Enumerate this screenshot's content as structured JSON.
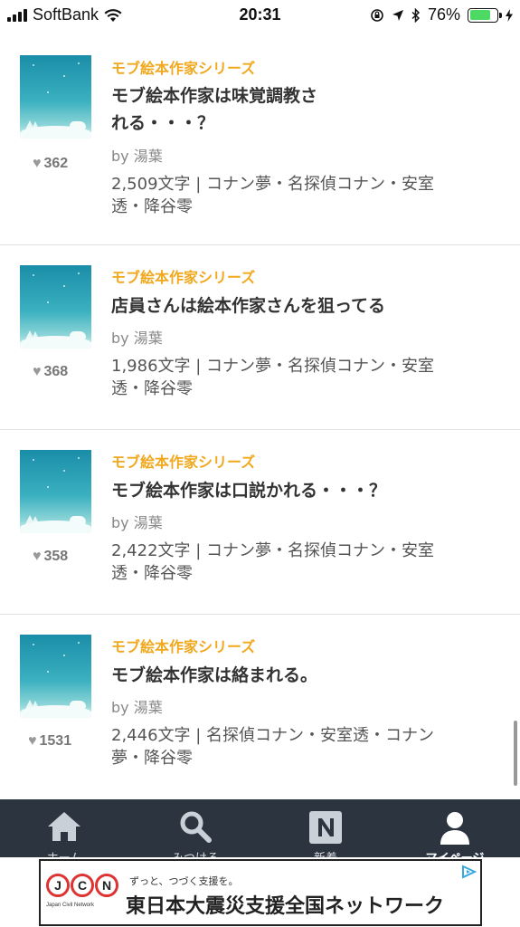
{
  "status_bar": {
    "carrier": "SoftBank",
    "time": "20:31",
    "battery": "76%",
    "battery_level": 0.76
  },
  "posts": [
    {
      "series": "モブ絵本作家シリーズ",
      "title_lines": [
        "モブ絵本作家は味覚調教さ",
        "れる・・・？"
      ],
      "author": "by 湯葉",
      "meta_lines": [
        "2,509文字 | コナン夢・名探偵コナン・安室",
        "透・降谷零"
      ],
      "likes": "362"
    },
    {
      "series": "モブ絵本作家シリーズ",
      "title_lines": [
        "店員さんは絵本作家さんを狙ってる"
      ],
      "author": "by 湯葉",
      "meta_lines": [
        "1,986文字 | コナン夢・名探偵コナン・安室",
        "透・降谷零"
      ],
      "likes": "368"
    },
    {
      "series": "モブ絵本作家シリーズ",
      "title_lines": [
        "モブ絵本作家は口説かれる・・・？"
      ],
      "author": "by 湯葉",
      "meta_lines": [
        "2,422文字 | コナン夢・名探偵コナン・安室",
        "透・降谷零"
      ],
      "likes": "358"
    },
    {
      "series": "モブ絵本作家シリーズ",
      "title_lines": [
        "モブ絵本作家は絡まれる。"
      ],
      "author": "by 湯葉",
      "meta_lines": [
        "2,446文字 | 名探偵コナン・安室透・コナン",
        "夢・降谷零"
      ],
      "likes": "1531"
    }
  ],
  "tabs": [
    {
      "label": "ホーム",
      "icon": "home-icon"
    },
    {
      "label": "みつける",
      "icon": "search-icon"
    },
    {
      "label": "新着",
      "icon": "new-n-icon"
    },
    {
      "label": "マイページ",
      "icon": "person-icon",
      "active": true
    }
  ],
  "ad": {
    "logo": [
      "J",
      "C",
      "N"
    ],
    "logo_sub": "Japan Civil Network",
    "tagline": "ずっと、つづく支援を。",
    "headline": "東日本大震災支援全国ネットワーク",
    "choice_icon": "adchoices-icon"
  },
  "colors": {
    "series": "#f0a91f",
    "tabbar": "#2c3440",
    "battery": "#4cd964"
  }
}
